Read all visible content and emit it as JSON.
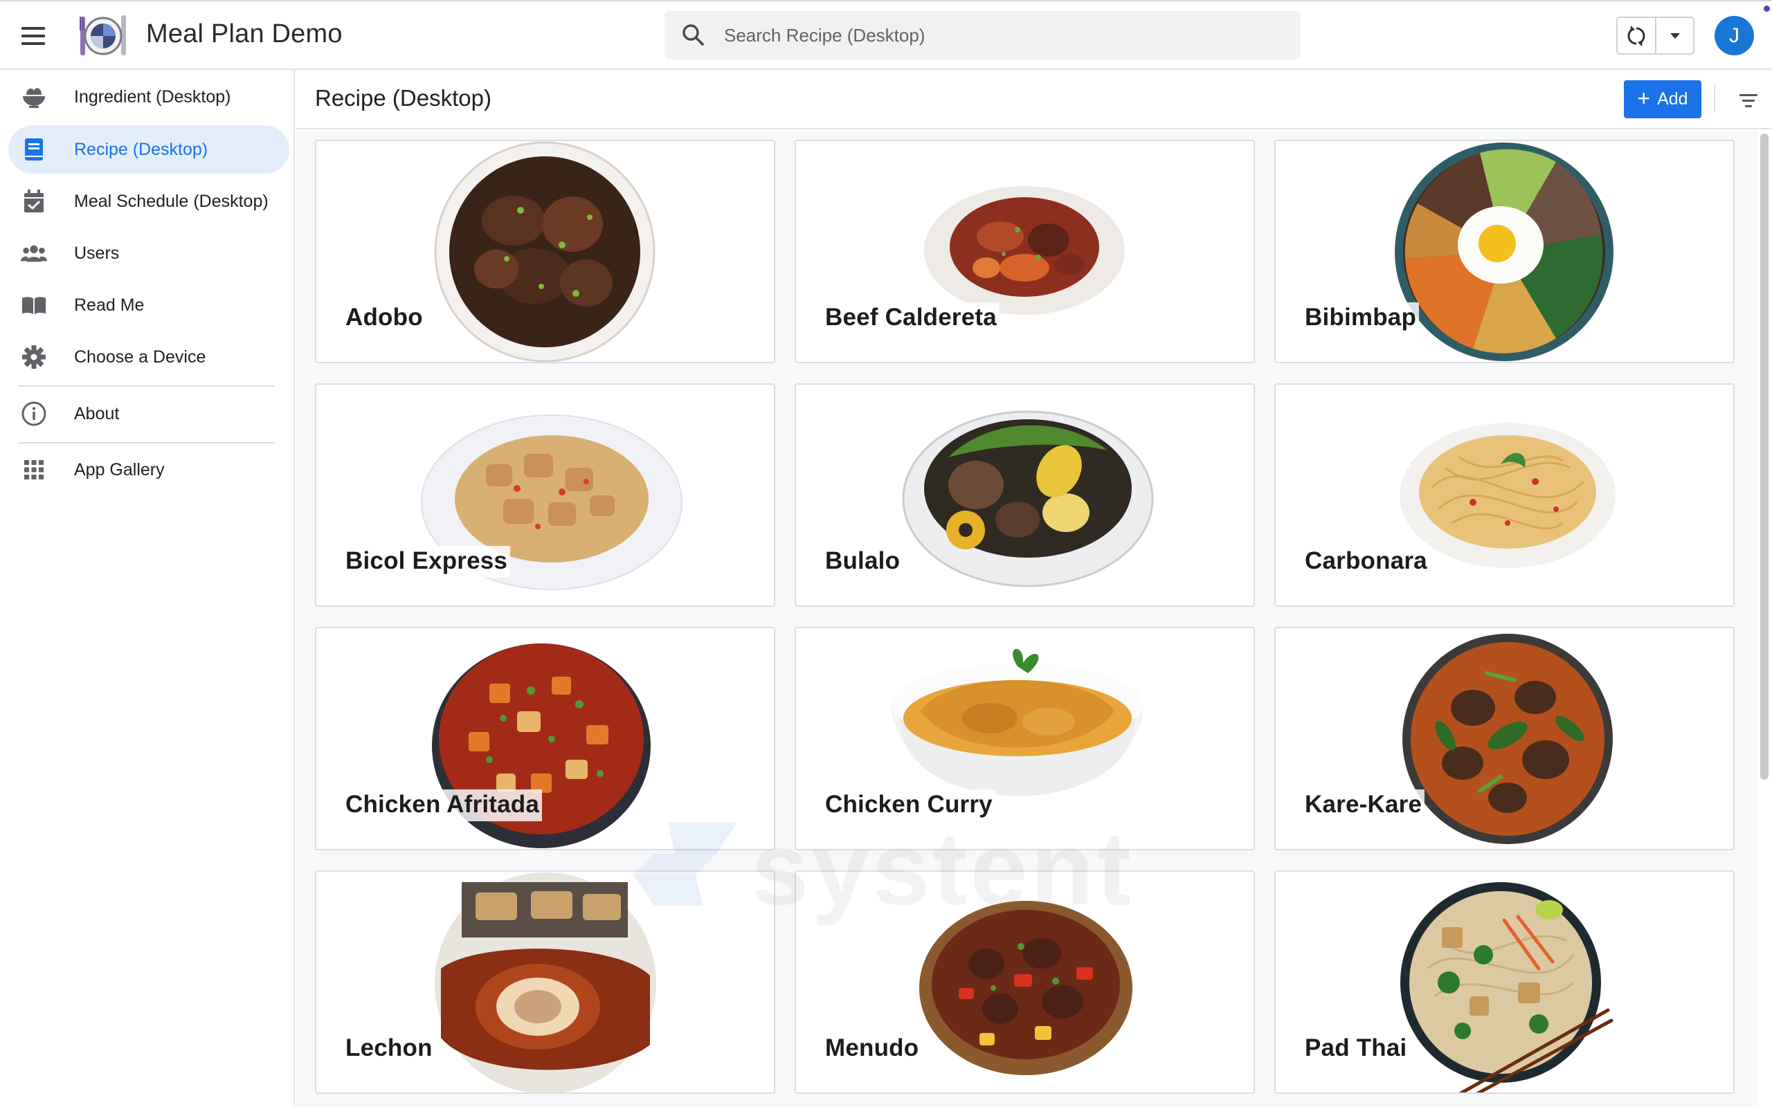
{
  "app": {
    "title": "Meal Plan Demo"
  },
  "search": {
    "placeholder": "Search Recipe (Desktop)"
  },
  "user": {
    "avatar_letter": "J"
  },
  "sidebar": {
    "items": [
      {
        "label": "Ingredient (Desktop)",
        "icon": "salad-bowl-icon"
      },
      {
        "label": "Recipe (Desktop)",
        "icon": "book-icon",
        "active": true
      },
      {
        "label": "Meal Schedule (Desktop)",
        "icon": "calendar-check-icon"
      },
      {
        "label": "Users",
        "icon": "users-icon"
      },
      {
        "label": "Read Me",
        "icon": "open-book-icon"
      },
      {
        "label": "Choose a Device",
        "icon": "gear-icon"
      },
      {
        "label": "About",
        "icon": "info-icon"
      },
      {
        "label": "App Gallery",
        "icon": "grid-icon"
      }
    ]
  },
  "main": {
    "title": "Recipe (Desktop)",
    "add_label": "Add"
  },
  "recipes": [
    {
      "name": "Adobo"
    },
    {
      "name": "Beef Caldereta"
    },
    {
      "name": "Bibimbap"
    },
    {
      "name": "Bicol Express"
    },
    {
      "name": "Bulalo"
    },
    {
      "name": "Carbonara"
    },
    {
      "name": "Chicken Afritada"
    },
    {
      "name": "Chicken Curry"
    },
    {
      "name": "Kare-Kare"
    },
    {
      "name": "Lechon"
    },
    {
      "name": "Menudo"
    },
    {
      "name": "Pad Thai"
    }
  ],
  "watermark": {
    "text": "systent"
  },
  "colors": {
    "accent": "#1a73e8",
    "active_bg": "#e4eefb",
    "avatar": "#1877d6"
  }
}
